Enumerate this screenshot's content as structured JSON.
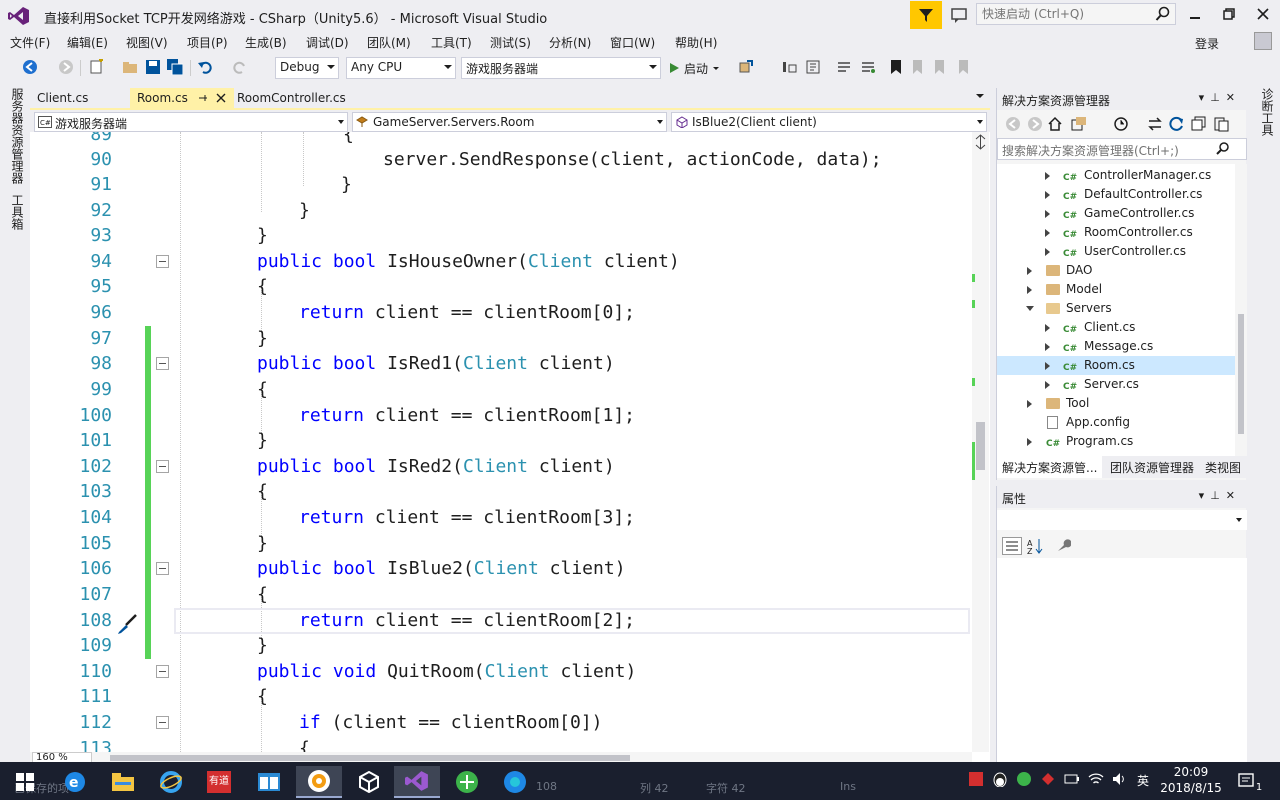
{
  "window": {
    "title": "直接利用Socket TCP开发网络游戏 - CSharp（Unity5.6） - Microsoft Visual Studio",
    "quick_launch_placeholder": "快速启动 (Ctrl+Q)",
    "sign_in": "登录"
  },
  "menu": [
    "文件(F)",
    "编辑(E)",
    "视图(V)",
    "项目(P)",
    "生成(B)",
    "调试(D)",
    "团队(M)",
    "工具(T)",
    "测试(S)",
    "分析(N)",
    "窗口(W)",
    "帮助(H)"
  ],
  "toolbar": {
    "config": "Debug",
    "platform": "Any CPU",
    "startup_project": "游戏服务器端",
    "start_label": "启动"
  },
  "left_strip": [
    "服务器资源管理器",
    "工具箱"
  ],
  "right_strip": [
    "诊断工具"
  ],
  "doc_tabs": [
    {
      "label": "Client.cs",
      "active": false
    },
    {
      "label": "Room.cs",
      "active": true
    },
    {
      "label": "RoomController.cs",
      "active": false
    }
  ],
  "nav": {
    "project": "游戏服务器端",
    "type": "GameServer.Servers.Room",
    "member": "IsBlue2(Client client)"
  },
  "code_lines": [
    {
      "n": "89",
      "text": "{"
    },
    {
      "n": "90",
      "text": "server.SendResponse(client, actionCode, data);"
    },
    {
      "n": "91",
      "text": "}"
    },
    {
      "n": "92",
      "text": "}"
    },
    {
      "n": "93",
      "text": "}"
    },
    {
      "n": "94",
      "text": "public bool IsHouseOwner(Client client)"
    },
    {
      "n": "95",
      "text": "{"
    },
    {
      "n": "96",
      "text": "return client == clientRoom[0];"
    },
    {
      "n": "97",
      "text": "}"
    },
    {
      "n": "98",
      "text": "public bool IsRed1(Client client)"
    },
    {
      "n": "99",
      "text": "{"
    },
    {
      "n": "100",
      "text": "return client == clientRoom[1];"
    },
    {
      "n": "101",
      "text": "}"
    },
    {
      "n": "102",
      "text": "public bool IsRed2(Client client)"
    },
    {
      "n": "103",
      "text": "{"
    },
    {
      "n": "104",
      "text": "return client == clientRoom[3];"
    },
    {
      "n": "105",
      "text": "}"
    },
    {
      "n": "106",
      "text": "public bool IsBlue2(Client client)"
    },
    {
      "n": "107",
      "text": "{"
    },
    {
      "n": "108",
      "text": "return client == clientRoom[2];"
    },
    {
      "n": "109",
      "text": "}"
    },
    {
      "n": "110",
      "text": "public void QuitRoom(Client client)"
    },
    {
      "n": "111",
      "text": "{"
    },
    {
      "n": "112",
      "text": "if (client == clientRoom[0])"
    },
    {
      "n": "113",
      "text": "{"
    }
  ],
  "zoom": "160 %",
  "solution_explorer": {
    "title": "解决方案资源管理器",
    "search_placeholder": "搜索解决方案资源管理器(Ctrl+;)",
    "items": [
      {
        "label": "ControllerManager.cs",
        "kind": "cs"
      },
      {
        "label": "DefaultController.cs",
        "kind": "cs"
      },
      {
        "label": "GameController.cs",
        "kind": "cs"
      },
      {
        "label": "RoomController.cs",
        "kind": "cs"
      },
      {
        "label": "UserController.cs",
        "kind": "cs"
      },
      {
        "label": "DAO",
        "kind": "folder"
      },
      {
        "label": "Model",
        "kind": "folder"
      },
      {
        "label": "Servers",
        "kind": "folder-open"
      },
      {
        "label": "Client.cs",
        "kind": "cs"
      },
      {
        "label": "Message.cs",
        "kind": "cs"
      },
      {
        "label": "Room.cs",
        "kind": "cs",
        "selected": true
      },
      {
        "label": "Server.cs",
        "kind": "cs"
      },
      {
        "label": "Tool",
        "kind": "folder"
      },
      {
        "label": "App.config",
        "kind": "config"
      },
      {
        "label": "Program.cs",
        "kind": "cs"
      }
    ],
    "tabs": [
      "解决方案资源管...",
      "团队资源管理器",
      "类视图"
    ]
  },
  "properties": {
    "title": "属性"
  },
  "status_ghost": {
    "ready": "已保存的项",
    "line": "108",
    "col": "列 42",
    "ch": "字符 42",
    "ins": "Ins"
  },
  "taskbar": {
    "time": "20:09",
    "date": "2018/8/15",
    "ime": "英",
    "notifications": "1",
    "youdao": "有道"
  },
  "colors": {
    "accent": "#007acc",
    "keyword": "#0000ff",
    "type": "#2b91af",
    "changed": "#57d357",
    "active_tab": "#fff1a7",
    "quick_filter": "#ffc700"
  }
}
